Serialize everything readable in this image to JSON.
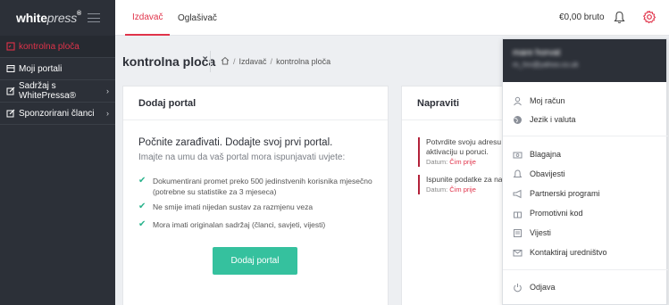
{
  "brand": {
    "logo_main": "white",
    "logo_accent": "press",
    "logo_reg": "®"
  },
  "sidebar": {
    "items": [
      {
        "label": "kontrolna ploča",
        "icon": "dashboard-icon",
        "active": true
      },
      {
        "label": "Moji portali",
        "icon": "portal-icon"
      },
      {
        "label": "Sadržaj s WhitePressa®",
        "icon": "edit-icon",
        "has_submenu": true
      },
      {
        "label": "Sponzorirani članci",
        "icon": "article-icon",
        "has_submenu": true
      }
    ]
  },
  "topbar": {
    "tabs": [
      "Izdavač",
      "Oglašivač"
    ],
    "balance": "€0,00 bruto"
  },
  "page": {
    "title": "kontrolna ploča",
    "breadcrumb": [
      "Izdavač",
      "kontrolna ploča"
    ]
  },
  "add_portal": {
    "title": "Dodaj portal",
    "lead": "Počnite zarađivati. Dodajte svoj prvi portal.",
    "sub": "Imajte na umu da vaš portal mora ispunjavati uvjete:",
    "requirements": [
      [
        "Dokumentirani promet preko 500 jedinstvenih korisnika mjesečno",
        "(potrebne su statistike za 3 mjeseca)"
      ],
      [
        "Ne smije imati nijedan sustav za razmjenu veza"
      ],
      [
        "Mora imati originalan sadržaj (članci, savjeti, vijesti)"
      ]
    ],
    "button": "Dodaj portal"
  },
  "todo": {
    "title": "Napraviti",
    "items": [
      {
        "lines": [
          "Potvrdite svoju adresu e",
          "aktivaciju u poruci."
        ],
        "date_label": "Datum:",
        "date_value": "Čim prije"
      },
      {
        "lines": [
          "Ispunite podatke za nap"
        ],
        "date_label": "Datum:",
        "date_value": "Čim prije"
      }
    ]
  },
  "user_menu": {
    "name": "mare horvat",
    "email": "m_hrv@yahoo.co.uk",
    "items": [
      {
        "label": "Moj račun",
        "icon": "user-icon"
      },
      {
        "label": "Jezik i valuta",
        "icon": "globe-icon"
      },
      {
        "label": "Blagajna",
        "icon": "cash-icon"
      },
      {
        "label": "Obavijesti",
        "icon": "bell-icon"
      },
      {
        "label": "Partnerski programi",
        "icon": "megaphone-icon"
      },
      {
        "label": "Promotivni kod",
        "icon": "gift-icon"
      },
      {
        "label": "Vijesti",
        "icon": "news-icon"
      },
      {
        "label": "Kontaktiraj uredništvo",
        "icon": "mail-icon"
      },
      {
        "label": "Odjava",
        "icon": "power-icon"
      }
    ]
  },
  "colors": {
    "accent": "#e0334a",
    "sidebar": "#2c3038",
    "button": "#35c19e"
  }
}
